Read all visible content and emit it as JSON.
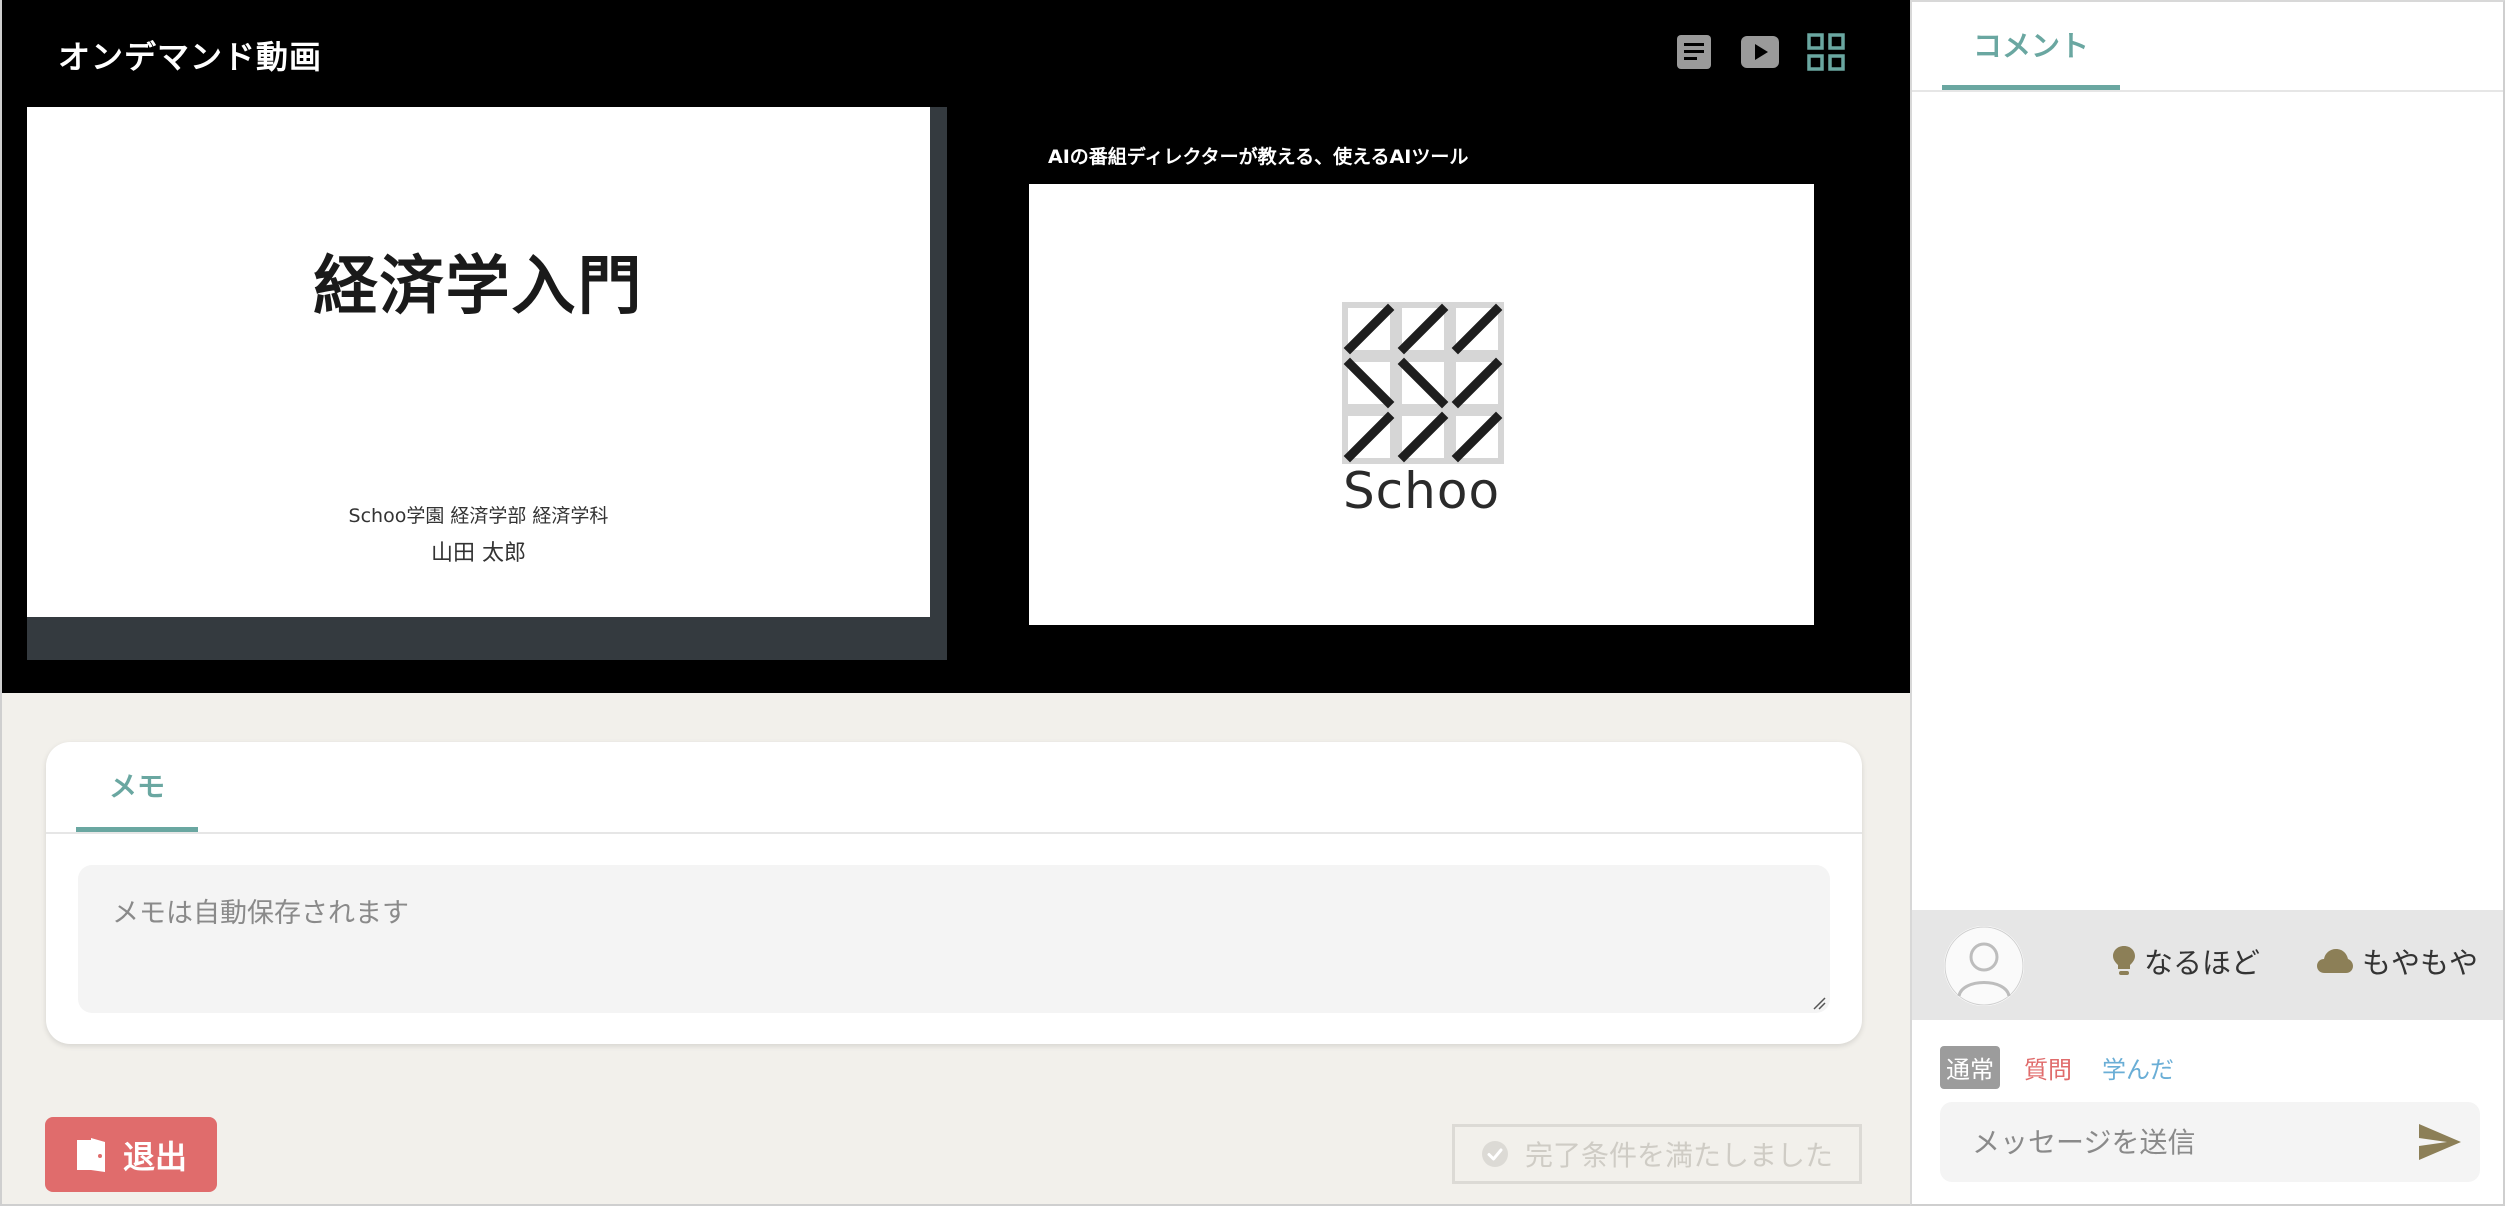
{
  "header": {
    "title": "オンデマンド動画"
  },
  "view_icons": [
    {
      "name": "document-view-icon",
      "active": false
    },
    {
      "name": "video-view-icon",
      "active": false
    },
    {
      "name": "grid-view-icon",
      "active": true
    }
  ],
  "slide": {
    "title": "経済学入門",
    "affiliation": "Schoo学園 経済学部 経済学科",
    "author": "山田 太郎"
  },
  "video": {
    "title": "AIの番組ディレクターが教える、使えるAIツール",
    "logo_text": "Schoo"
  },
  "memo": {
    "tab_label": "メモ",
    "placeholder": "メモは自動保存されます"
  },
  "buttons": {
    "exit_label": "退出",
    "complete_label": "完了条件を満たしました"
  },
  "comments": {
    "tab_label": "コメント",
    "reactions": {
      "naruhodo": "なるほど",
      "moyamoya": "もやもや"
    },
    "type_tabs": {
      "normal": "通常",
      "question": "質問",
      "learned": "学んだ"
    },
    "message_placeholder": "メッセージを送信"
  },
  "colors": {
    "accent": "#6aa7a1",
    "exit": "#e06c6c",
    "question": "#e06c6c",
    "learned": "#6aaed6",
    "reaction_icon": "#8c7f57"
  }
}
